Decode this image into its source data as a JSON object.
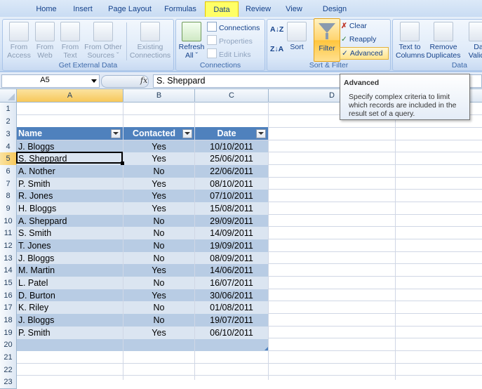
{
  "ribbon": {
    "tabs": [
      "Home",
      "Insert",
      "Page Layout",
      "Formulas",
      "Data",
      "Review",
      "View",
      "Design"
    ],
    "active_tab": "Data",
    "groups": {
      "external": {
        "label": "Get External Data",
        "from_access": [
          "From",
          "Access"
        ],
        "from_web": [
          "From",
          "Web"
        ],
        "from_text": [
          "From",
          "Text"
        ],
        "from_other": [
          "From Other",
          "Sources ˇ"
        ],
        "existing": [
          "Existing",
          "Connections"
        ]
      },
      "connections": {
        "label": "Connections",
        "refresh": [
          "Refresh",
          "All ˇ"
        ],
        "connections": "Connections",
        "properties": "Properties",
        "edit_links": "Edit Links"
      },
      "sort_filter": {
        "label": "Sort & Filter",
        "sort": "Sort",
        "filter": "Filter",
        "clear": "Clear",
        "reapply": "Reapply",
        "advanced": "Advanced"
      },
      "data_tools": {
        "label": "Data",
        "text_to_columns": [
          "Text to",
          "Columns"
        ],
        "remove_duplicates": [
          "Remove",
          "Duplicates"
        ],
        "data_validation": [
          "Da",
          "Valida"
        ]
      }
    }
  },
  "formula_bar": {
    "name_box": "A5",
    "fx": "fx",
    "value": "S. Sheppard"
  },
  "tooltip": {
    "title": "Advanced",
    "body": "Specify complex criteria to limit which records are included in the result set of a query."
  },
  "columns": [
    "A",
    "B",
    "C",
    "D"
  ],
  "rows": [
    "1",
    "2",
    "3",
    "4",
    "5",
    "6",
    "7",
    "8",
    "9",
    "10",
    "11",
    "12",
    "13",
    "14",
    "15",
    "16",
    "17",
    "18",
    "19",
    "20",
    "21",
    "22",
    "23"
  ],
  "table": {
    "headers": [
      "Name",
      "Contacted",
      "Date"
    ],
    "records": [
      [
        "J. Bloggs",
        "Yes",
        "10/10/2011"
      ],
      [
        "S. Sheppard",
        "Yes",
        "25/06/2011"
      ],
      [
        "A. Nother",
        "No",
        "22/06/2011"
      ],
      [
        "P. Smith",
        "Yes",
        "08/10/2011"
      ],
      [
        "R. Jones",
        "Yes",
        "07/10/2011"
      ],
      [
        "H. Bloggs",
        "Yes",
        "15/08/2011"
      ],
      [
        "A. Sheppard",
        "No",
        "29/09/2011"
      ],
      [
        "S. Smith",
        "No",
        "14/09/2011"
      ],
      [
        "T. Jones",
        "No",
        "19/09/2011"
      ],
      [
        "J. Bloggs",
        "No",
        "08/09/2011"
      ],
      [
        "M. Martin",
        "Yes",
        "14/06/2011"
      ],
      [
        "L. Patel",
        "No",
        "16/07/2011"
      ],
      [
        "D. Burton",
        "Yes",
        "30/06/2011"
      ],
      [
        "K. Riley",
        "No",
        "01/08/2011"
      ],
      [
        "J.  Bloggs",
        "No",
        "19/07/2011"
      ],
      [
        "P. Smith",
        "Yes",
        "06/10/2011"
      ]
    ]
  },
  "colors": {
    "header_fill": "#4f81bd",
    "band_dark": "#b8cce4",
    "band_light": "#dbe5f1",
    "accent_highlight": "#ffff66"
  }
}
